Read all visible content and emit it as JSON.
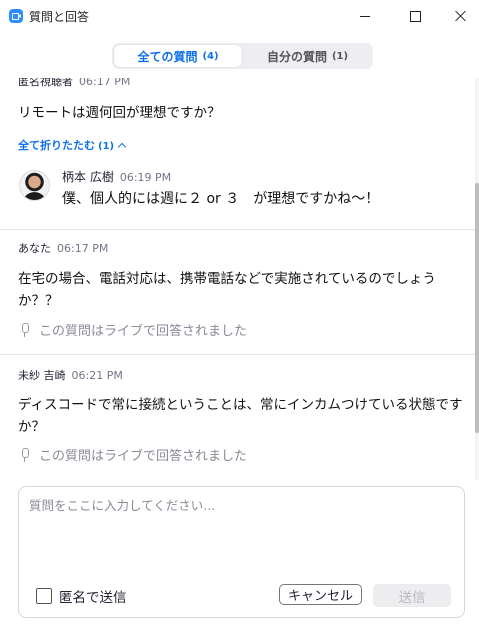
{
  "window": {
    "title": "質問と回答"
  },
  "tabs": [
    {
      "label": "全ての質問",
      "count": "(4)"
    },
    {
      "label": "自分の質問",
      "count": "(1)"
    }
  ],
  "questions": [
    {
      "author": "匿名視聴者",
      "time": "06:17 PM",
      "text": "リモートは週何回が理想ですか？",
      "collapse_label": "全て折りたたむ",
      "collapse_count": "(1)",
      "answer": {
        "author": "柄本 広樹",
        "time": "06:19 PM",
        "text": "僕、個人的には週に２ or ３　が理想ですかね～！"
      }
    },
    {
      "author": "あなた",
      "time": "06:17 PM",
      "text_line1": "在宅の場合、電話対応は、携帯電話などで実施されているのでしょう",
      "text_line2": "か？？",
      "status": "この質問はライブで回答されました"
    },
    {
      "author": "未紗 吉崎",
      "time": "06:21 PM",
      "text_line1": "ディスコードで常に接続ということは、常にインカムつけている状態です",
      "text_line2": "か？",
      "status": "この質問はライブで回答されました"
    }
  ],
  "composer": {
    "placeholder": "質問をここに入力してください...",
    "anonymous_label": "匿名で送信",
    "cancel_label": "キャンセル",
    "send_label": "送信"
  },
  "colors": {
    "accent": "#0e71eb",
    "brand": "#2D8CFF",
    "muted": "#8a8a98"
  }
}
